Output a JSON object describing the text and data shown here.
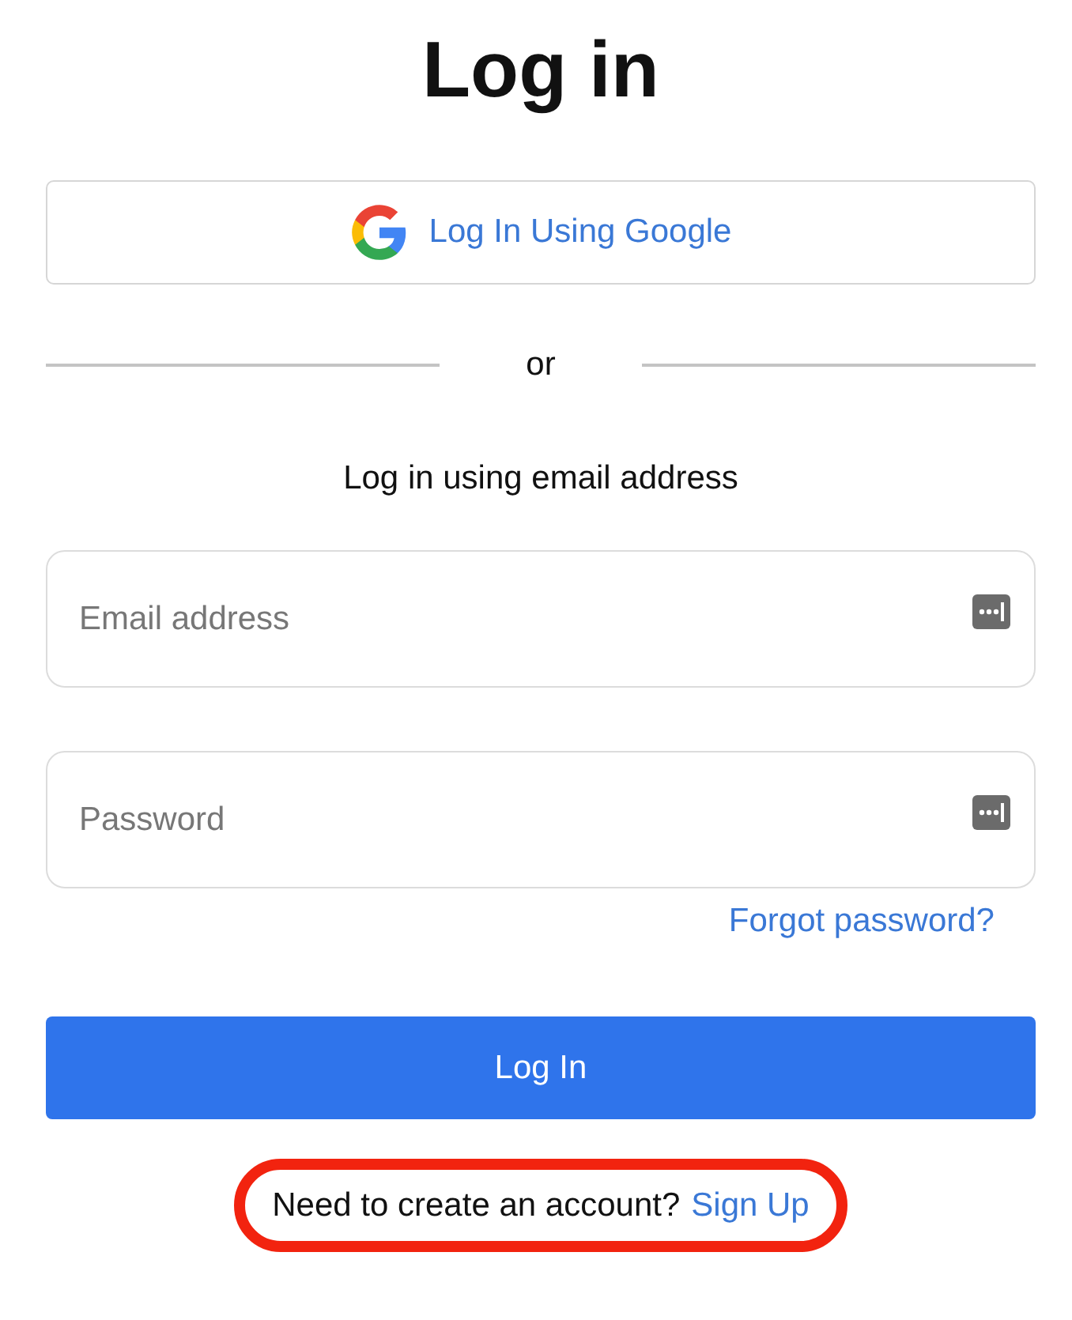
{
  "title": "Log in",
  "google_button": {
    "label": "Log In Using Google"
  },
  "divider": {
    "label": "or"
  },
  "email_heading": "Log in using email address",
  "fields": [
    {
      "placeholder": "Email address"
    },
    {
      "placeholder": "Password"
    }
  ],
  "forgot_link": "Forgot password?",
  "submit_button": {
    "label": "Log In"
  },
  "signup_prompt": {
    "text": "Need to create an account?",
    "link": "Sign Up",
    "highlighted": true
  }
}
